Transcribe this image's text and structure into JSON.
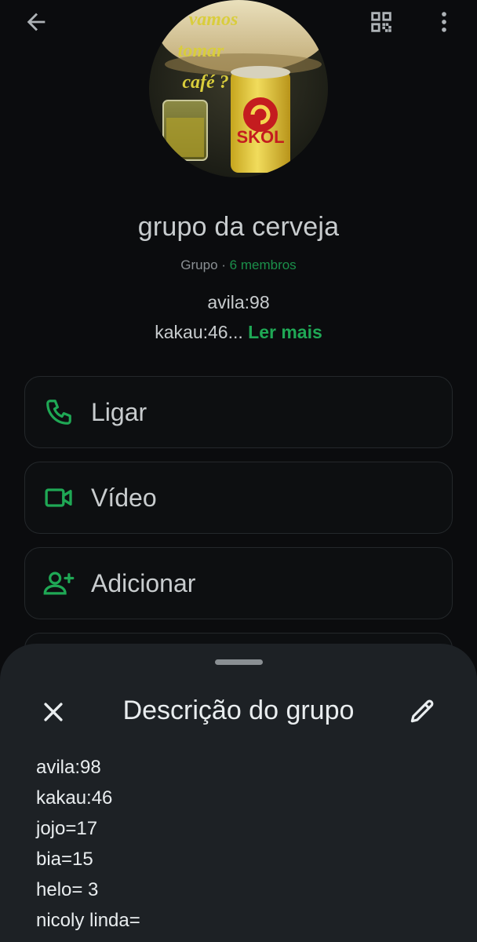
{
  "header": {
    "back_icon": "arrow-left-icon",
    "qr_icon": "qr-code-icon",
    "more_icon": "more-vertical-icon"
  },
  "avatar": {
    "overlay_text": [
      "vamos",
      "tomar",
      "café ?"
    ],
    "can_label": "SKOL"
  },
  "group": {
    "name": "grupo da cerveja",
    "type_label": "Grupo",
    "separator": " · ",
    "members_label": "6 membros"
  },
  "description_preview": {
    "line1": "avila:98",
    "line2": "kakau:46...",
    "read_more": "Ler mais"
  },
  "actions": [
    {
      "label": "Ligar",
      "icon": "phone-icon"
    },
    {
      "label": "Vídeo",
      "icon": "video-camera-icon"
    },
    {
      "label": "Adicionar",
      "icon": "add-person-icon"
    }
  ],
  "sheet": {
    "title": "Descrição do grupo",
    "close_icon": "close-icon",
    "edit_icon": "pencil-icon",
    "lines": [
      "avila:98",
      "kakau:46",
      "jojo=17",
      "bia=15",
      "helo= 3",
      "nicoly linda="
    ]
  },
  "colors": {
    "background": "#0b0c0e",
    "accent": "#1fa855",
    "sheet_bg": "#1d2125",
    "card_border": "#24282b"
  }
}
